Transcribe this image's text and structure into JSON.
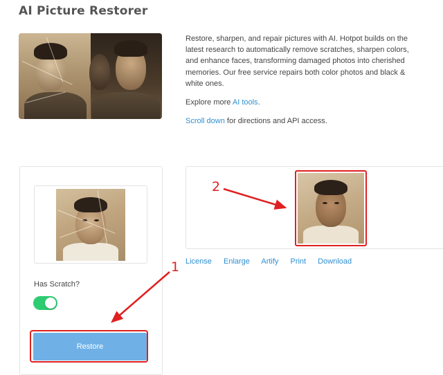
{
  "page": {
    "title": "AI Picture Restorer"
  },
  "intro": {
    "paragraph1": "Restore, sharpen, and repair pictures with AI. Hotpot builds on the latest research to automatically remove scratches, sharpen colors, and enhance faces, transforming damaged photos into cherished memories. Our free service repairs both color photos and black & white ones.",
    "explore_prefix": "Explore more ",
    "explore_link": "AI tools",
    "explore_suffix": ".",
    "scroll_link": "Scroll down",
    "scroll_suffix": " for directions and API access."
  },
  "form": {
    "has_scratch_label": "Has Scratch?",
    "has_scratch_on": true,
    "restore_button": "Restore"
  },
  "result_actions": [
    "License",
    "Enlarge",
    "Artify",
    "Print",
    "Download"
  ],
  "annotations": {
    "marker1": "1",
    "marker2": "2"
  },
  "colors": {
    "accent_link": "#2f8fd0",
    "restore_button": "#6fb1e6",
    "toggle_on": "#2ecc71",
    "annotation_red": "#e02020"
  }
}
